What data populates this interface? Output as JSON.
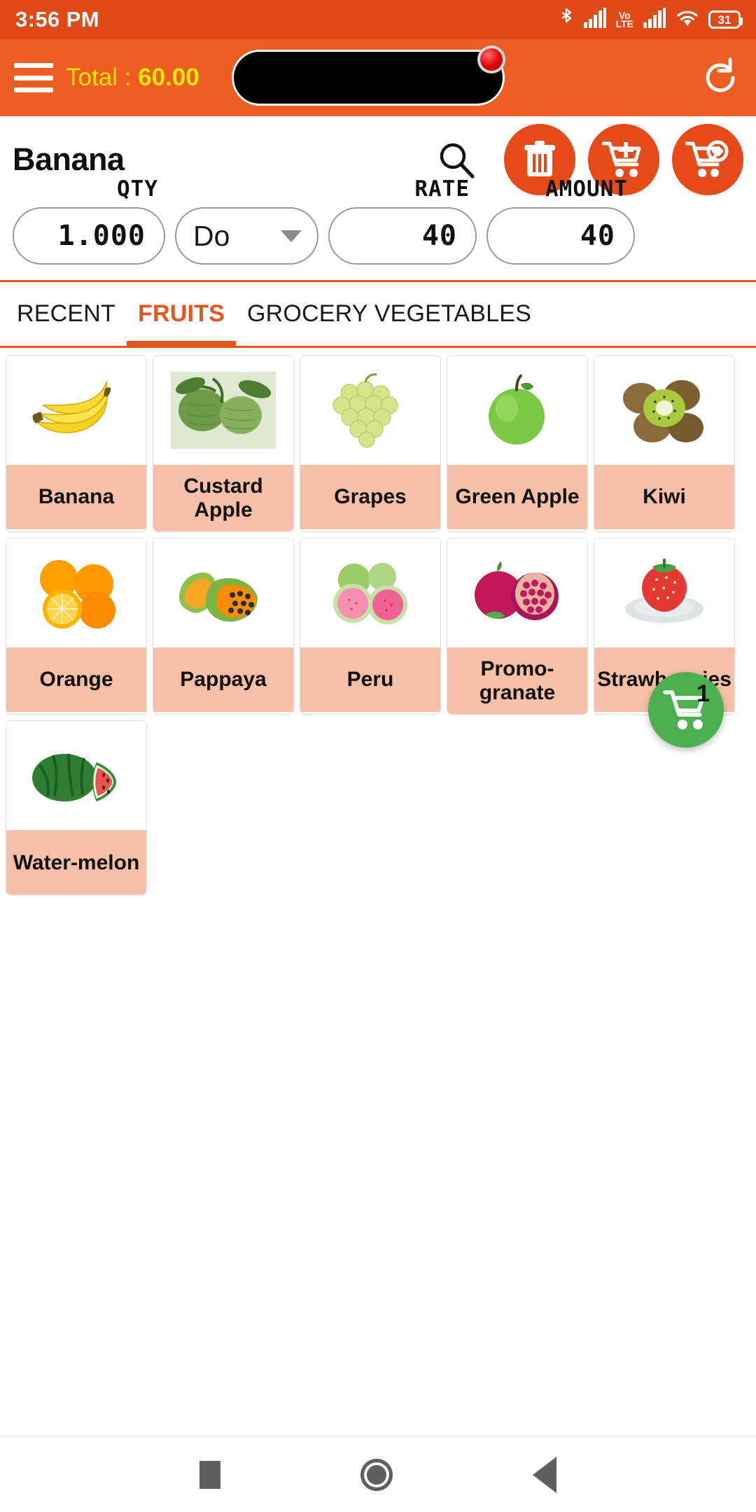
{
  "status_bar": {
    "time": "3:56 PM",
    "battery_level": "31",
    "volte_top": "Vo",
    "volte_bottom": "LTE",
    "icons": [
      "bluetooth-icon",
      "signal-icon",
      "volte-icon",
      "signal-icon",
      "wifi-icon",
      "battery-icon"
    ]
  },
  "app_bar": {
    "menu_icon": "hamburger-menu-icon",
    "total_prefix": "Total : ",
    "total_value": "60.00",
    "search_value": "",
    "search_placeholder": "",
    "refresh_icon": "refresh-icon",
    "background": "#ed5c20",
    "total_color": "#ffe500"
  },
  "product_detail": {
    "title": "Banana",
    "search_icon": "search-icon",
    "actions": [
      {
        "name": "delete-button",
        "icon": "trash-icon"
      },
      {
        "name": "add-to-cart-button",
        "icon": "cart-plus-icon"
      },
      {
        "name": "checkout-cart-button",
        "icon": "cart-arrow-right-icon"
      }
    ],
    "fields": {
      "qty_label": "QTY",
      "qty_value": "1.000",
      "unit_value": "Do",
      "unit_caret": "chevron-down-icon",
      "rate_label": "RATE",
      "rate_value": "40",
      "amount_label": "AMOUNT",
      "amount_value": "40"
    }
  },
  "tabs": [
    {
      "label": "RECENT",
      "active": false
    },
    {
      "label": "FRUITS",
      "active": true
    },
    {
      "label": "GROCERY VEGETABLES",
      "active": false
    }
  ],
  "cart_fab": {
    "icon": "shopping-cart-icon",
    "badge": "1",
    "color": "#4caf50"
  },
  "products": [
    {
      "name": "Banana",
      "image": "banana-image"
    },
    {
      "name": "Custard Apple",
      "image": "custard-apple-image"
    },
    {
      "name": "Grapes",
      "image": "grapes-image"
    },
    {
      "name": "Green Apple",
      "image": "green-apple-image"
    },
    {
      "name": "Kiwi",
      "image": "kiwi-image"
    },
    {
      "name": "Orange",
      "image": "orange-image"
    },
    {
      "name": "Pappaya",
      "image": "pappaya-image"
    },
    {
      "name": "Peru",
      "image": "peru-image"
    },
    {
      "name": "Promo-granate",
      "image": "pomegranate-image"
    },
    {
      "name": "Strawber-ries",
      "image": "strawberries-image"
    },
    {
      "name": "Water-melon",
      "image": "watermelon-image"
    }
  ],
  "nav_bar": {
    "recents": "recents-square-icon",
    "home": "home-circle-icon",
    "back": "back-triangle-icon"
  }
}
